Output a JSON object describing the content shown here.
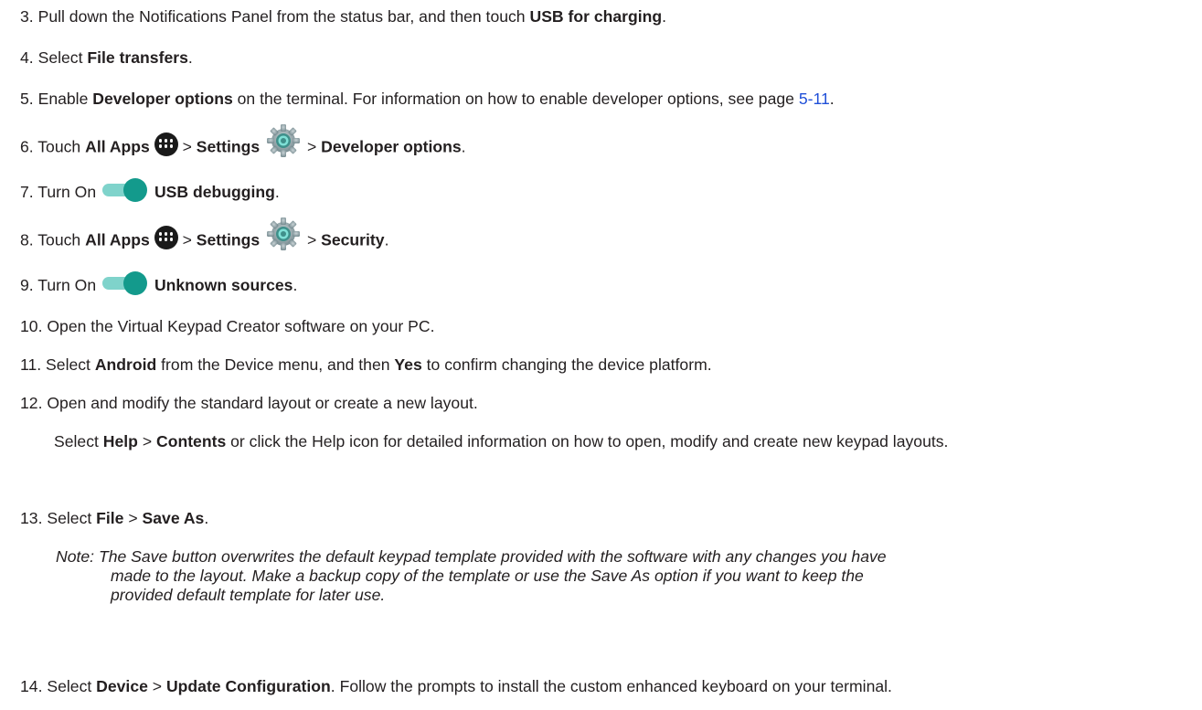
{
  "steps": {
    "s3": {
      "num": "3.",
      "t1": "Pull down the Notifications Panel from the status bar, and then touch ",
      "b1": "USB for charging",
      "t2": "."
    },
    "s4": {
      "num": "4.",
      "t1": "Select ",
      "b1": "File transfers",
      "t2": "."
    },
    "s5": {
      "num": "5.",
      "t1": "Enable ",
      "b1": "Developer options",
      "t2": " on the terminal. For information on how to enable developer options, see page ",
      "link": "5-11",
      "t3": "."
    },
    "s6": {
      "num": "6.",
      "t1": "Touch ",
      "b1": "All Apps",
      "sep1": " > ",
      "b2": "Settings",
      "sep2": " > ",
      "b3": "Developer options",
      "t2": "."
    },
    "s7": {
      "num": "7.",
      "t1": "Turn On ",
      "b1": "USB debugging",
      "t2": "."
    },
    "s8": {
      "num": "8.",
      "t1": "Touch ",
      "b1": "All Apps",
      "sep1": " > ",
      "b2": "Settings",
      "sep2": " > ",
      "b3": "Security",
      "t2": "."
    },
    "s9": {
      "num": "9.",
      "t1": "Turn On ",
      "b1": "Unknown sources",
      "t2": "."
    },
    "s10": {
      "num": "10.",
      "t1": "Open the Virtual Keypad Creator software on your PC."
    },
    "s11": {
      "num": "11.",
      "t1": "Select ",
      "b1": "Android",
      "t2": " from the Device menu, and then ",
      "b2": "Yes",
      "t3": " to confirm changing the device platform."
    },
    "s12": {
      "num": "12.",
      "t1": "Open and modify the standard layout or create a new layout."
    },
    "s12p": {
      "t1": "Select ",
      "b1": "Help",
      "sep1": " > ",
      "b2": "Contents",
      "t2": " or click the Help icon for detailed information on how to open, modify and create new keypad layouts."
    },
    "s13": {
      "num": "13.",
      "t1": "Select ",
      "b1": "File",
      "sep1": " > ",
      "b2": "Save As",
      "t2": "."
    },
    "note": {
      "label": "Note:",
      "line1": " The Save button overwrites the default keypad template provided with the software with any changes you have",
      "line2": "made to the layout. Make a backup copy of the template or use the Save As option if you want to keep the",
      "line3": "provided default template for later use."
    },
    "s14": {
      "num": "14.",
      "t1": "Select ",
      "b1": "Device",
      "sep1": " > ",
      "b2": "Update Configuration",
      "t2": ". Follow the prompts to install the custom enhanced keyboard on your terminal."
    }
  },
  "icons": {
    "apps": "all-apps-icon",
    "settings": "settings-gear-icon",
    "toggle": "toggle-on-icon"
  },
  "colors": {
    "text": "#231f20",
    "link": "#1f4fd8",
    "toggle_track": "#7fd3cb",
    "toggle_knob": "#139a8c",
    "gear": "#8fa3a8"
  }
}
